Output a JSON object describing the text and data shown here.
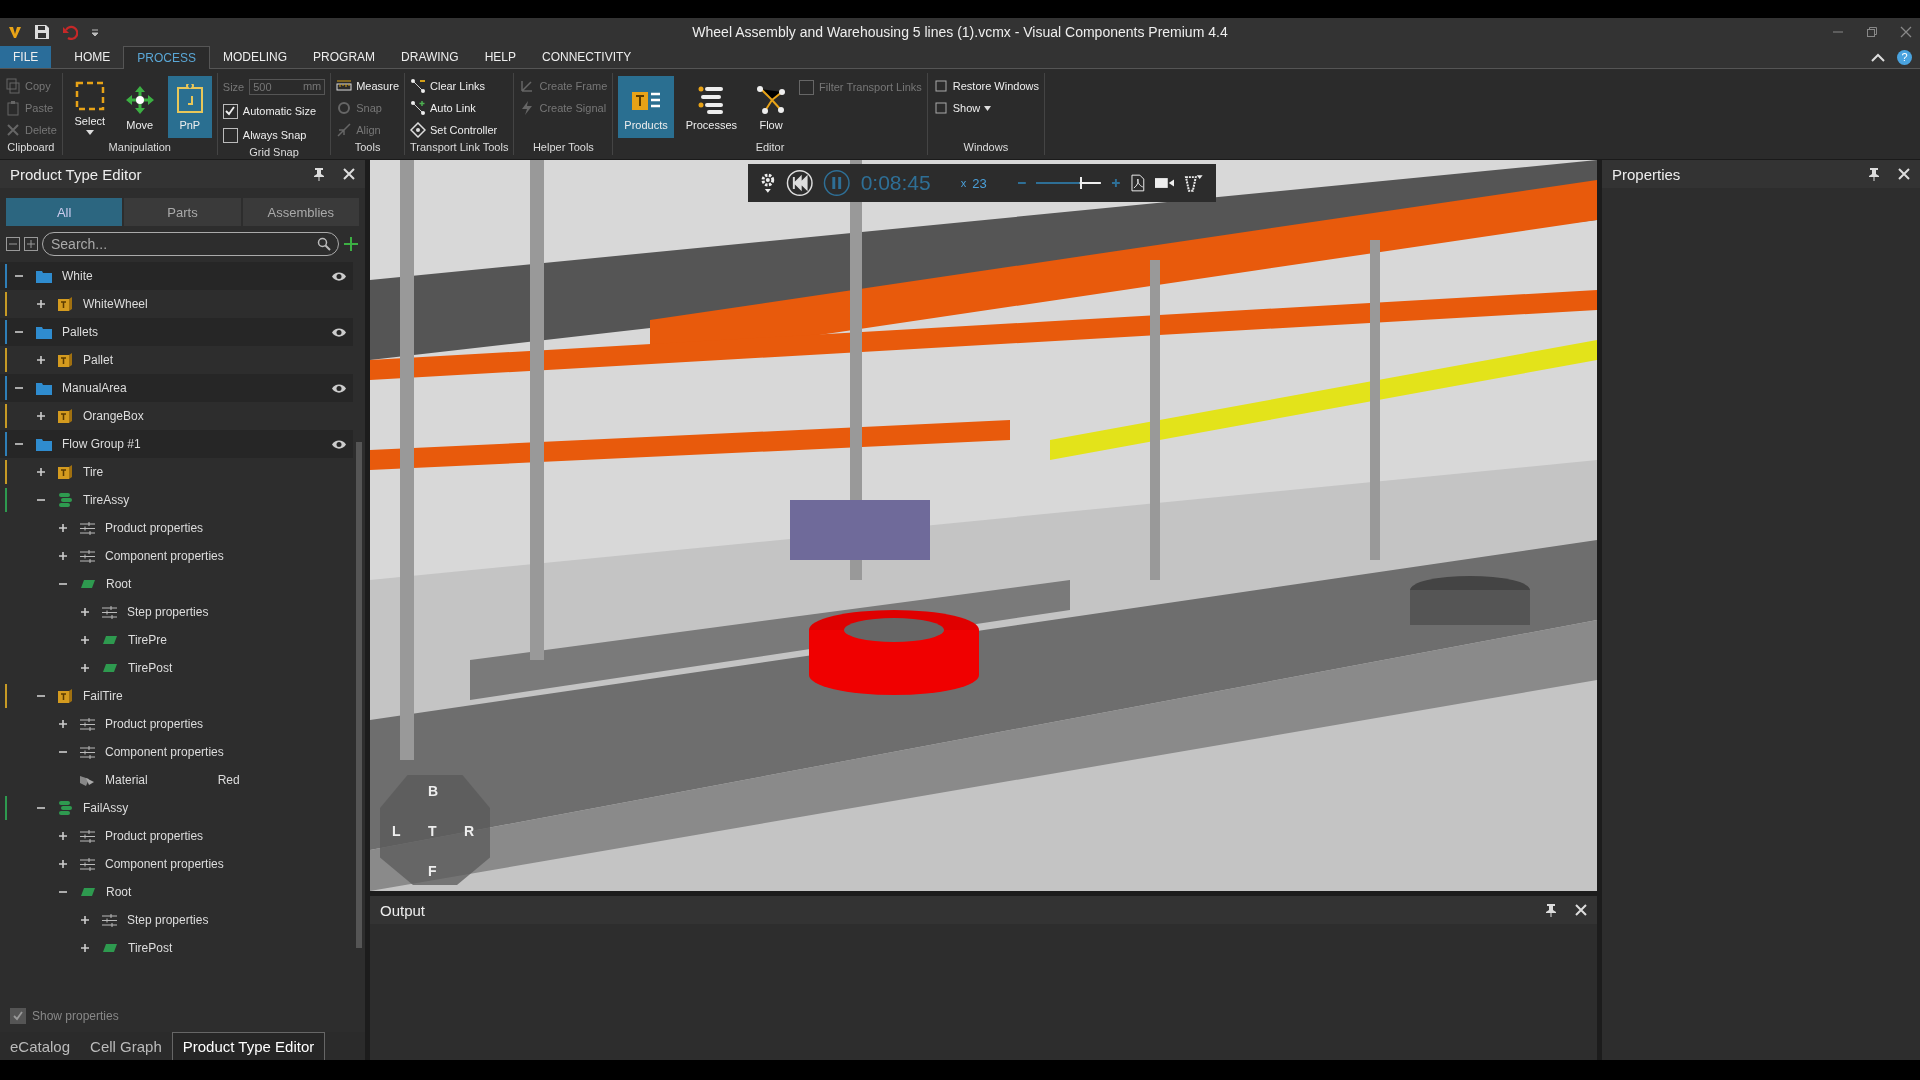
{
  "window": {
    "title": "Wheel Assembly and Warehousing 5 lines (1).vcmx - Visual Components Premium 4.4",
    "help": "?"
  },
  "menu_tabs": [
    {
      "label": "FILE",
      "kind": "file",
      "selected": false
    },
    {
      "label": "HOME",
      "kind": "tab",
      "selected": false
    },
    {
      "label": "PROCESS",
      "kind": "tab",
      "selected": true
    },
    {
      "label": "MODELING",
      "kind": "tab",
      "selected": false
    },
    {
      "label": "PROGRAM",
      "kind": "tab",
      "selected": false
    },
    {
      "label": "DRAWING",
      "kind": "tab",
      "selected": false
    },
    {
      "label": "HELP",
      "kind": "tab",
      "selected": false
    },
    {
      "label": "CONNECTIVITY",
      "kind": "tab",
      "selected": false
    }
  ],
  "ribbon": [
    {
      "label": "Clipboard",
      "items": [
        {
          "kind": "small",
          "label": "Copy",
          "disabled": true
        },
        {
          "kind": "small",
          "label": "Paste",
          "disabled": true
        },
        {
          "kind": "small",
          "label": "Delete",
          "disabled": true
        }
      ]
    },
    {
      "label": "Manipulation",
      "items": [
        {
          "kind": "large",
          "label": "Select",
          "selected": false,
          "dropdown": true
        },
        {
          "kind": "large",
          "label": "Move",
          "selected": false,
          "dropdown": false
        },
        {
          "kind": "large",
          "label": "PnP",
          "selected": true,
          "dropdown": false
        }
      ]
    },
    {
      "label": "Grid Snap",
      "items": [
        {
          "kind": "field",
          "label": "Size",
          "value": "500",
          "unit": "mm",
          "disabled": true
        },
        {
          "kind": "check",
          "label": "Automatic Size",
          "checked": true,
          "disabled": false
        },
        {
          "kind": "check",
          "label": "Always Snap",
          "checked": false,
          "disabled": false
        }
      ]
    },
    {
      "label": "Tools",
      "items": [
        {
          "kind": "small",
          "label": "Measure",
          "disabled": false
        },
        {
          "kind": "small",
          "label": "Snap",
          "disabled": true
        },
        {
          "kind": "small",
          "label": "Align",
          "disabled": true
        }
      ]
    },
    {
      "label": "Transport Link Tools",
      "items": [
        {
          "kind": "small",
          "label": "Clear Links",
          "disabled": false
        },
        {
          "kind": "small",
          "label": "Auto Link",
          "disabled": false
        },
        {
          "kind": "small",
          "label": "Set Controller",
          "disabled": false
        }
      ]
    },
    {
      "label": "Helper Tools",
      "items": [
        {
          "kind": "small",
          "label": "Create Frame",
          "disabled": true
        },
        {
          "kind": "small",
          "label": "Create Signal",
          "disabled": true
        }
      ]
    },
    {
      "label": "Editor",
      "items": [
        {
          "kind": "large",
          "label": "Products",
          "selected": true,
          "dropdown": false
        },
        {
          "kind": "large",
          "label": "Processes",
          "selected": false,
          "dropdown": false
        },
        {
          "kind": "large",
          "label": "Flow",
          "selected": false,
          "dropdown": false
        },
        {
          "kind": "check",
          "label": "Filter Transport Links",
          "checked": false,
          "disabled": true
        }
      ]
    },
    {
      "label": "Windows",
      "items": [
        {
          "kind": "small",
          "label": "Restore Windows",
          "disabled": false
        },
        {
          "kind": "small",
          "label": "Show",
          "disabled": false,
          "dropdown": true
        }
      ]
    }
  ],
  "product_type_editor": {
    "title": "Product Type Editor",
    "filter_tabs": [
      {
        "label": "All",
        "selected": true
      },
      {
        "label": "Parts",
        "selected": false
      },
      {
        "label": "Assemblies",
        "selected": false
      }
    ],
    "search": {
      "placeholder": "Search..."
    },
    "tree": [
      {
        "label": "White",
        "kind": "folder",
        "expanded": true,
        "visible": true,
        "children": [
          {
            "label": "WhiteWheel",
            "kind": "part",
            "expanded": false
          }
        ]
      },
      {
        "label": "Pallets",
        "kind": "folder",
        "expanded": true,
        "visible": true,
        "children": [
          {
            "label": "Pallet",
            "kind": "part",
            "expanded": false
          }
        ]
      },
      {
        "label": "ManualArea",
        "kind": "folder",
        "expanded": true,
        "visible": true,
        "children": [
          {
            "label": "OrangeBox",
            "kind": "part",
            "expanded": false
          }
        ]
      },
      {
        "label": "Flow Group #1",
        "kind": "folder",
        "expanded": true,
        "visible": true,
        "children": [
          {
            "label": "Tire",
            "kind": "part",
            "expanded": false
          },
          {
            "label": "TireAssy",
            "kind": "assembly",
            "expanded": true,
            "children": [
              {
                "label": "Product properties",
                "kind": "properties",
                "expanded": false
              },
              {
                "label": "Component properties",
                "kind": "properties",
                "expanded": false
              },
              {
                "label": "Root",
                "kind": "step",
                "expanded": true,
                "children": [
                  {
                    "label": "Step properties",
                    "kind": "properties",
                    "expanded": false
                  },
                  {
                    "label": "TirePre",
                    "kind": "step",
                    "expanded": false
                  },
                  {
                    "label": "TirePost",
                    "kind": "step",
                    "expanded": false
                  }
                ]
              }
            ]
          },
          {
            "label": "FailTire",
            "kind": "part",
            "expanded": true,
            "children": [
              {
                "label": "Product properties",
                "kind": "properties",
                "expanded": false
              },
              {
                "label": "Component properties",
                "kind": "properties",
                "expanded": true
              },
              {
                "label": "Material",
                "kind": "material",
                "value": "Red"
              }
            ]
          },
          {
            "label": "FailAssy",
            "kind": "assembly",
            "expanded": true,
            "children": [
              {
                "label": "Product properties",
                "kind": "properties",
                "expanded": false
              },
              {
                "label": "Component properties",
                "kind": "properties",
                "expanded": false
              },
              {
                "label": "Root",
                "kind": "step",
                "expanded": true,
                "children": [
                  {
                    "label": "Step properties",
                    "kind": "properties",
                    "expanded": false
                  },
                  {
                    "label": "TirePost",
                    "kind": "step",
                    "expanded": false
                  }
                ]
              }
            ]
          }
        ]
      }
    ],
    "show_properties": {
      "label": "Show properties",
      "checked": true,
      "disabled": true
    }
  },
  "bottom_tabs": [
    {
      "label": "eCatalog",
      "selected": false
    },
    {
      "label": "Cell Graph",
      "selected": false
    },
    {
      "label": "Product Type Editor",
      "selected": true
    }
  ],
  "playback": {
    "playing": true,
    "time": "0:08:45",
    "speed_prefix": "x",
    "speed": "23",
    "level": 0.7
  },
  "view_cube": {
    "top": "B",
    "left": "L",
    "center": "T",
    "right": "R",
    "bottom": "F"
  },
  "output": {
    "title": "Output"
  },
  "properties": {
    "title": "Properties"
  }
}
